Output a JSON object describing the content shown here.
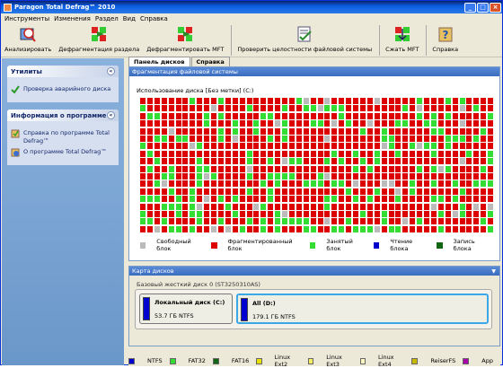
{
  "window": {
    "title": "Paragon Total Defrag™ 2010"
  },
  "menu": [
    "Инструменты",
    "Изменения",
    "Раздел",
    "Вид",
    "Справка"
  ],
  "toolbar": [
    {
      "label": "Анализировать",
      "icon": "analyze-icon"
    },
    {
      "label": "Дефрагментация раздела",
      "icon": "defrag-partition-icon"
    },
    {
      "label": "Дефрагментировать MFT",
      "icon": "defrag-mft-icon"
    },
    {
      "label": "Проверить целостности файловой системы",
      "icon": "check-fs-icon"
    },
    {
      "label": "Сжать MFT",
      "icon": "compress-mft-icon"
    },
    {
      "label": "Справка",
      "icon": "help-icon"
    }
  ],
  "sidebar": {
    "utilities": {
      "title": "Утилиты",
      "items": [
        "Проверка аварийного диска"
      ]
    },
    "about": {
      "title": "Информация о программе",
      "items": [
        "Справка по программе Total Defrag™",
        "О программе Total Defrag™"
      ]
    }
  },
  "tabs": [
    "Панель дисков",
    "Справка"
  ],
  "frag_panel": {
    "title": "Фрагментация файловой системы",
    "usage": "Использование диска [Без метки] (C:)",
    "legend": [
      {
        "label": "Свободный блок",
        "color": "#bbbbbb"
      },
      {
        "label": "Фрагментированный блок",
        "color": "#dd0000"
      },
      {
        "label": "Занятый блок",
        "color": "#33dd33"
      },
      {
        "label": "Чтение блока",
        "color": "#0000cc"
      },
      {
        "label": "Запись блока",
        "color": "#116611"
      }
    ]
  },
  "disk_panel": {
    "title": "Карта дисков",
    "hdd": "Базовый жесткий диск 0 (ST3250310AS)",
    "partitions": [
      {
        "name": "Локальный диск (C:)",
        "size": "53.7 ГБ NTFS"
      },
      {
        "name": "All (D:)",
        "size": "179.1 ГБ NTFS"
      }
    ]
  },
  "fs_legend": [
    {
      "label": "NTFS",
      "color": "#0000cc"
    },
    {
      "label": "FAT32",
      "color": "#33dd33"
    },
    {
      "label": "FAT16",
      "color": "#116611"
    },
    {
      "label": "Linux Ext2",
      "color": "#e8e000"
    },
    {
      "label": "Linux Ext3",
      "color": "#f5f060"
    },
    {
      "label": "Linux Ext4",
      "color": "#fff8c0"
    },
    {
      "label": "ReiserFS",
      "color": "#c8b800"
    },
    {
      "label": "App",
      "color": "#aa00aa"
    }
  ],
  "colors": {
    "free": "#bbbbbb",
    "frag": "#dd0000",
    "used": "#33dd33"
  }
}
